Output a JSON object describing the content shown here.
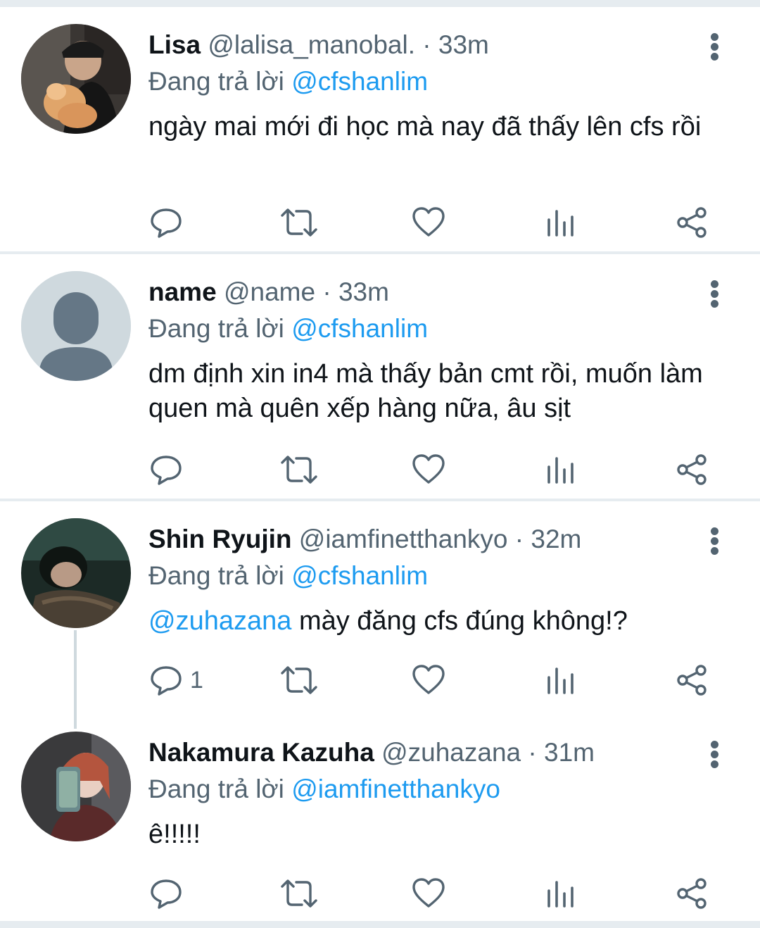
{
  "replying_prefix": "Đang trả lời",
  "tweets": [
    {
      "name": "Lisa",
      "handle": "@lalisa_manobal.",
      "dot": "·",
      "time": "33m",
      "reply_to": "@cfshanlim",
      "text": "ngày mai mới đi học mà nay đã thấy lên cfs rồi",
      "mention": "",
      "reply_count": ""
    },
    {
      "name": "name",
      "handle": "@name",
      "dot": "·",
      "time": "33m",
      "reply_to": "@cfshanlim",
      "text": "dm định xin in4 mà thấy bản cmt rồi, muốn làm quen mà quên xếp hàng nữa, âu sịt",
      "mention": "",
      "reply_count": ""
    },
    {
      "name": "Shin Ryujin",
      "handle": "@iamfinetthankyo",
      "dot": "·",
      "time": "32m",
      "reply_to": "@cfshanlim",
      "mention": "@zuhazana",
      "text": " mày đăng cfs đúng không!?",
      "reply_count": "1"
    },
    {
      "name": "Nakamura Kazuha",
      "handle": "@zuhazana",
      "dot": "·",
      "time": "31m",
      "reply_to": "@iamfinetthankyo",
      "text": "ê!!!!!",
      "mention": "",
      "reply_count": ""
    }
  ],
  "colors": {
    "text": "#0f1419",
    "secondary": "#536471",
    "accent": "#1d9bf0",
    "divider": "#e6ecf0",
    "thread_line": "#cfd9de"
  },
  "icons": [
    "reply-icon",
    "retweet-icon",
    "like-icon",
    "analytics-icon",
    "share-icon",
    "more-icon"
  ]
}
